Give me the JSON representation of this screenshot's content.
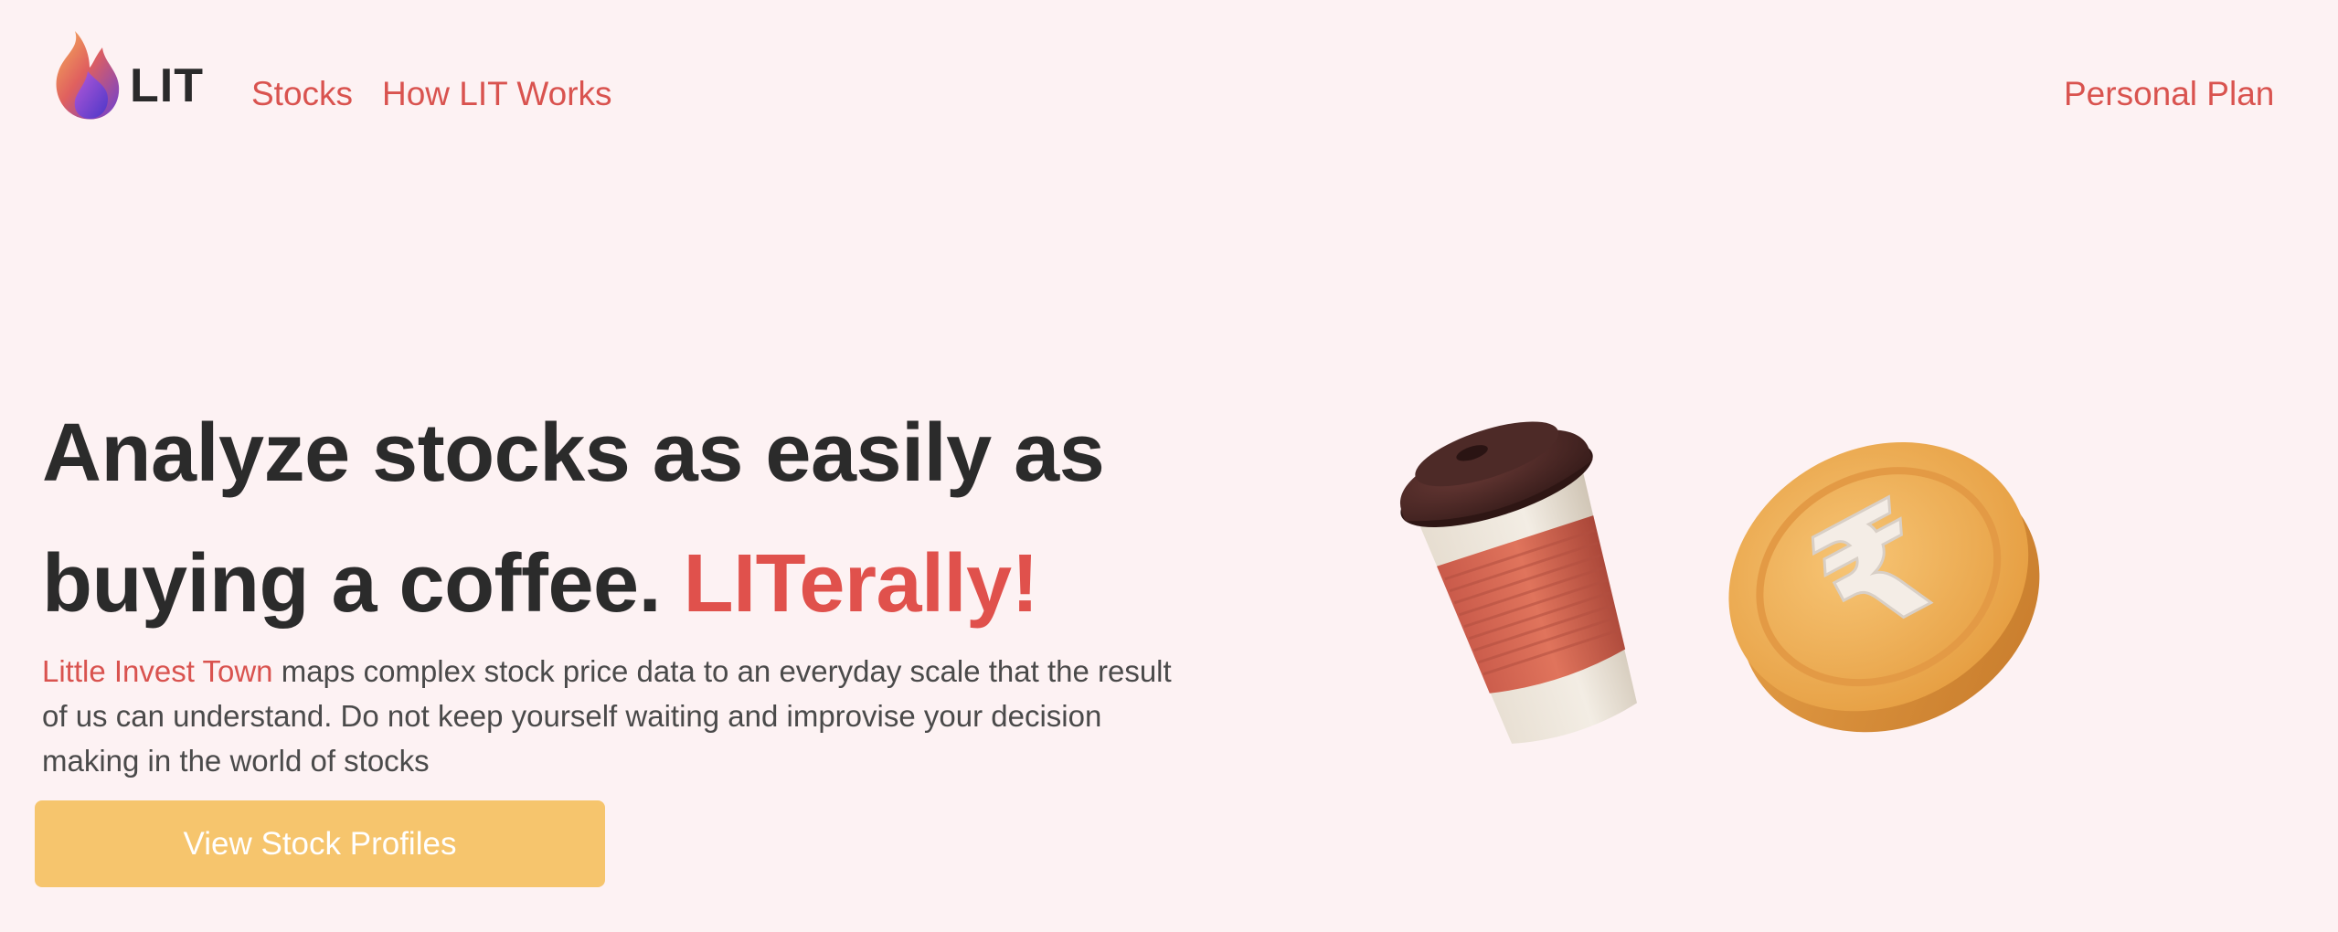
{
  "nav": {
    "logo_text": "LIT",
    "links": [
      {
        "label": "Stocks"
      },
      {
        "label": "How LIT Works"
      }
    ],
    "right_link": "Personal Plan"
  },
  "hero": {
    "headline_line1": "Analyze stocks as easily as",
    "headline_line2": "buying a coffee.",
    "headline_accent": "LITerally!",
    "description_brand": "Little Invest Town",
    "description_text": " maps complex stock price data to an everyday scale that the result of us can understand. Do not keep yourself waiting and improvise your decision making in the world of stocks",
    "cta_label": "View Stock Profiles"
  },
  "illustration": {
    "left_object": "coffee-cup-icon",
    "right_object": "rupee-coin-icon",
    "coin_symbol": "₹"
  },
  "colors": {
    "background": "#fdf2f3",
    "accent": "#e0514c",
    "button": "#f6c56d",
    "text": "#2b2b2b"
  }
}
